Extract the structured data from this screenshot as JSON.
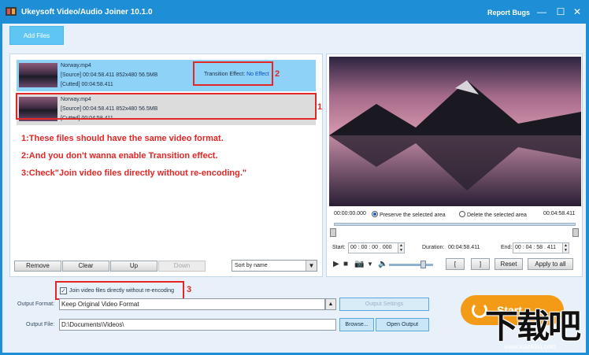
{
  "window": {
    "title": "Ukeysoft Video/Audio Joiner 10.1.0",
    "report_bugs": "Report Bugs",
    "minimize": "—",
    "maximize": "☐",
    "close": "✕"
  },
  "toolbar": {
    "add_files": "Add Files"
  },
  "files": [
    {
      "name": "Norway.mp4",
      "source": "[Source]  00:04:58.411  852x480  56.5MB",
      "cutted": "[Cutted]  00:04:58.411",
      "transition_label": "Transition Effect:",
      "transition_value": "No Effect"
    },
    {
      "name": "Norway.mp4",
      "source": "[Source]  00:04:58.411  852x480  56.5MB",
      "cutted": "[Cutted]  00:04:58.411"
    }
  ],
  "annotations": {
    "num1": "1",
    "num2": "2",
    "num3": "3",
    "note1": "1:These files should have the same video format.",
    "note2": "2:And you don't wanna enable Transition effect.",
    "note3": "3:Check\"Join video files directly without re-encoding.\""
  },
  "list_buttons": {
    "remove": "Remove",
    "clear": "Clear",
    "up": "Up",
    "down": "Down"
  },
  "sort": {
    "value": "Sort by name"
  },
  "player": {
    "time_start": "00:00:00.000",
    "preserve": "Preserve the selected area",
    "delete": "Delete the selected area",
    "time_end": "00:04:58.411",
    "start_label": "Start:",
    "start_value": "00 : 00 : 00 . 000",
    "duration_label": "Duration:",
    "duration_value": "00:04:58.411",
    "end_label": "End:",
    "end_value": "00 : 04 : 58 . 411",
    "bracket_open": "[",
    "bracket_close": "]",
    "reset": "Reset",
    "apply_all": "Apply to all"
  },
  "options": {
    "join_directly": "Join video files directly without re-encoding",
    "join_checked": true
  },
  "output": {
    "format_label": "Output Format:",
    "format_value": "Keep Original Video Format",
    "settings": "Output Settings",
    "file_label": "Output File:",
    "file_value": "D:\\Documents\\Videos\\",
    "browse": "Browse...",
    "open": "Open Output",
    "start": "Start"
  },
  "watermark": {
    "text": "下载吧",
    "url": "www.xiazaiba.com"
  },
  "colors": {
    "accent": "#1e8fd6",
    "start": "#f39a17",
    "annotation": "#e32626"
  },
  "icons": [
    "app-icon",
    "play-icon",
    "stop-icon",
    "camera-icon",
    "volume-icon"
  ]
}
